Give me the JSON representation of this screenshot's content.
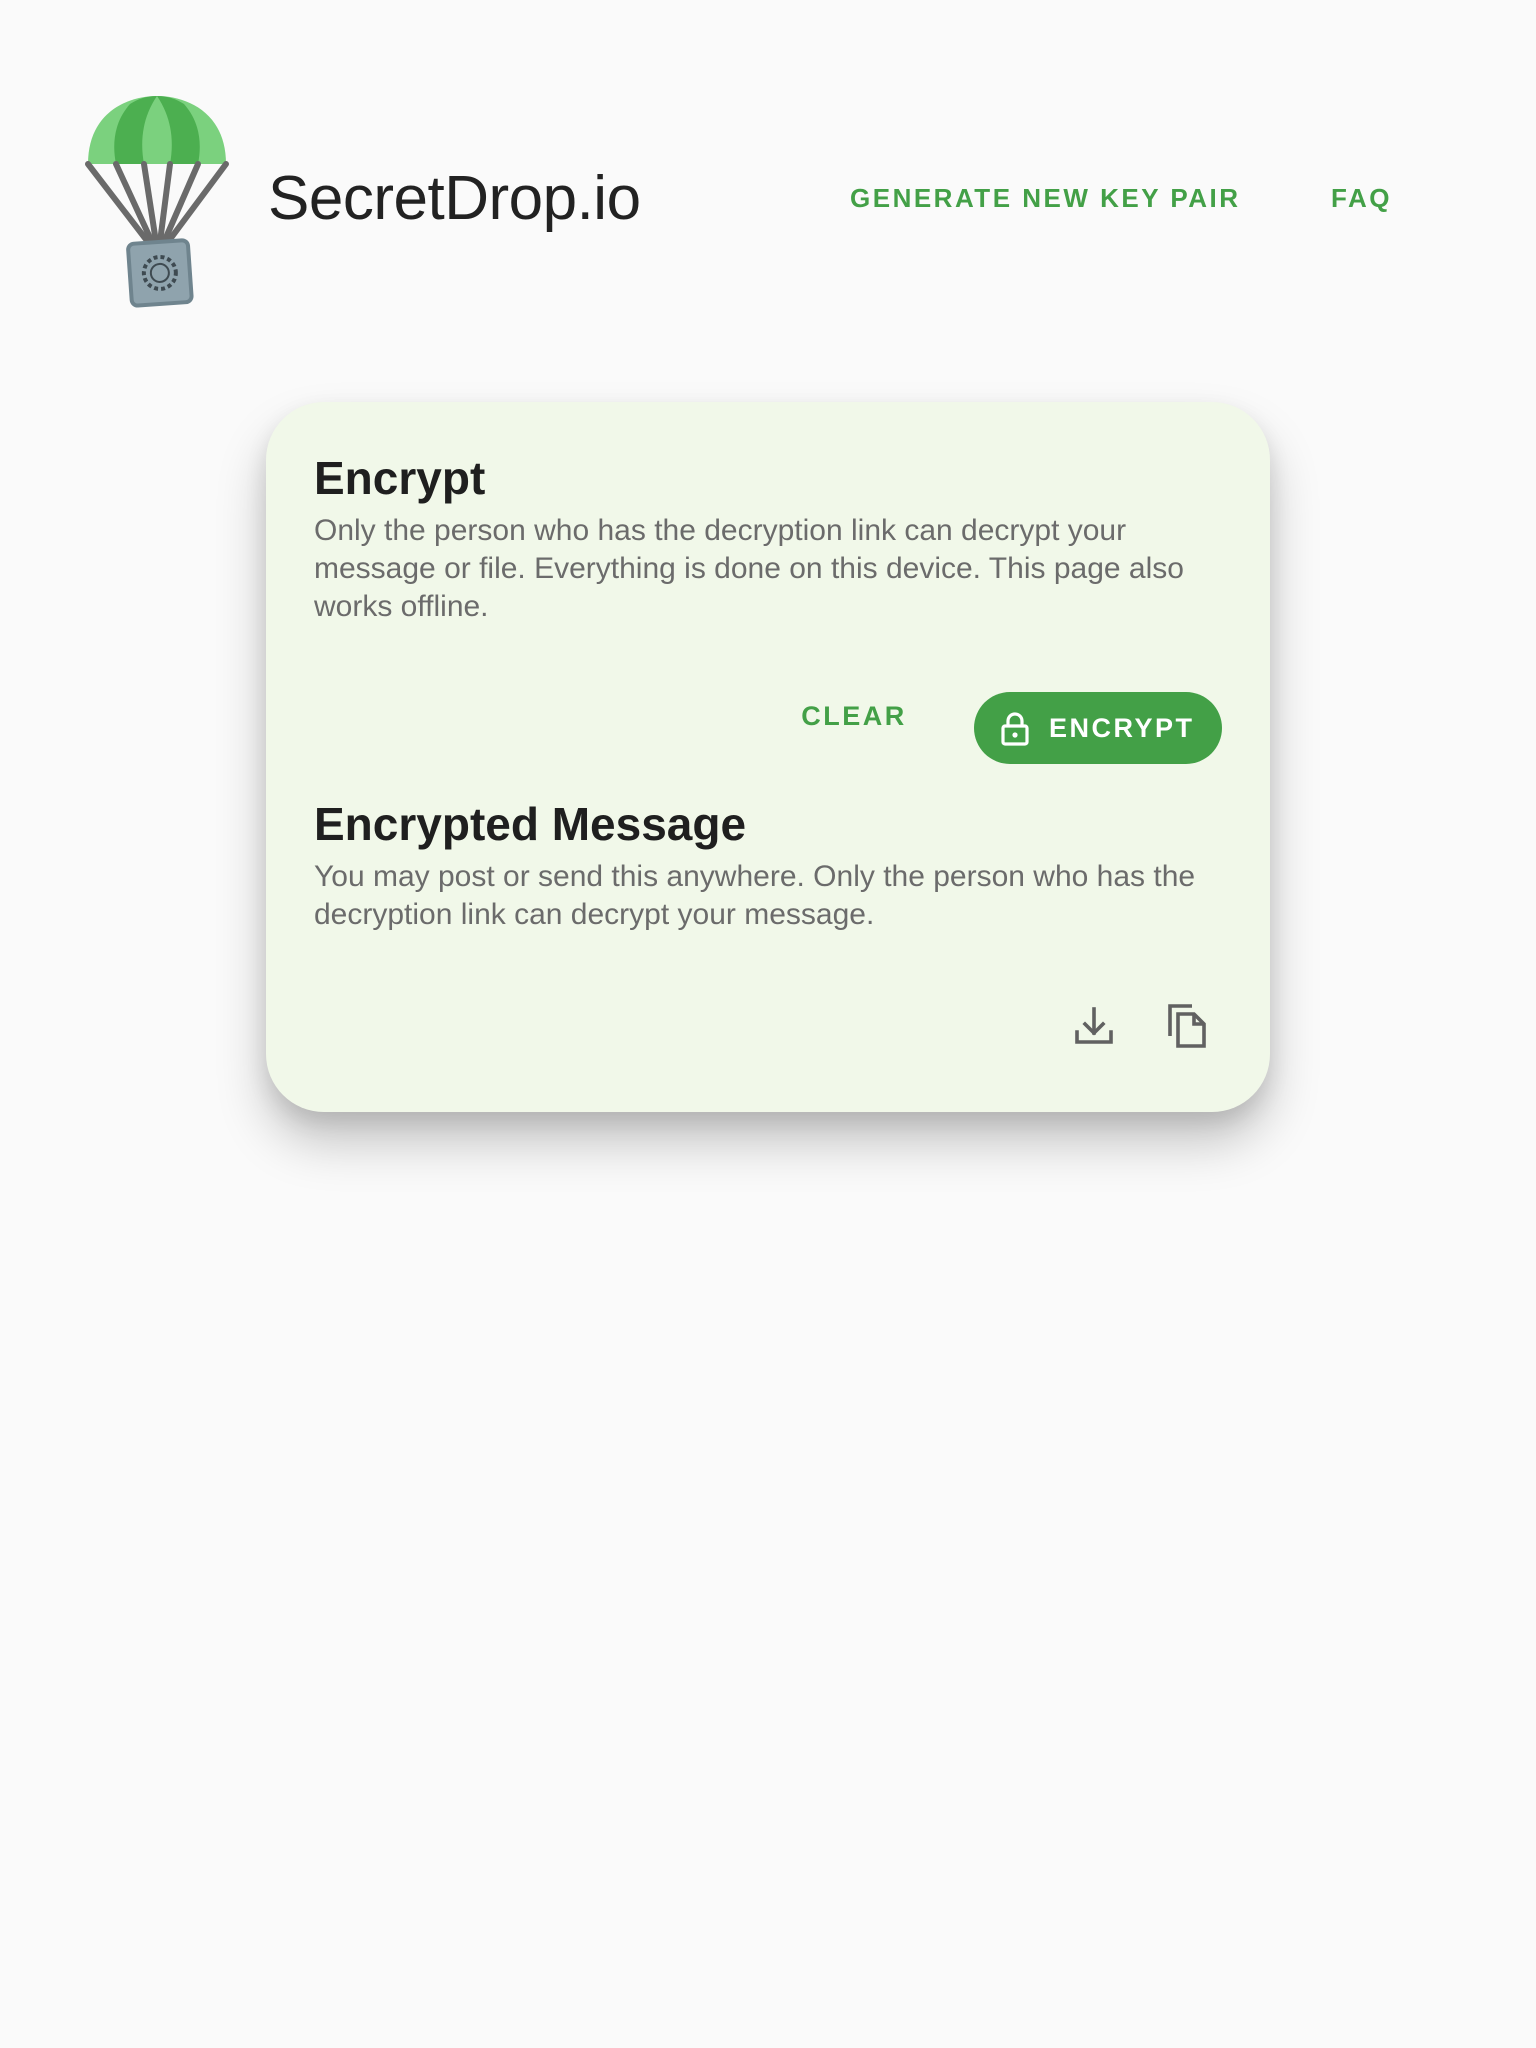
{
  "header": {
    "brand": "SecretDrop.io",
    "logo_icon": "parachute-safe-icon",
    "nav": {
      "generate_label": "GENERATE NEW KEY PAIR",
      "faq_label": "FAQ"
    }
  },
  "encrypt_section": {
    "title": "Encrypt",
    "description": "Only the person who has the decryption link can decrypt your message or file. Everything is done on this device. This page also works offline.",
    "clear_label": "CLEAR",
    "encrypt_label": "ENCRYPT",
    "encrypt_icon": "lock-icon"
  },
  "message_section": {
    "title": "Encrypted Message",
    "description": "You may post or send this anywhere. Only the person who has the decryption link can decrypt your message.",
    "actions": [
      "download-icon",
      "copy-icon"
    ]
  },
  "colors": {
    "accent": "#43a047",
    "card_background": "#f1f8e9",
    "page_background": "#fafafa"
  }
}
